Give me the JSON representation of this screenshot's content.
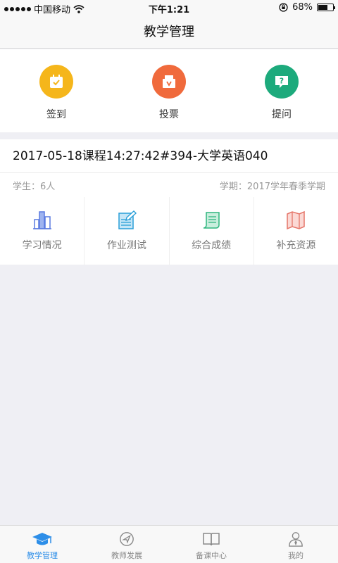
{
  "status": {
    "carrier": "中国移动",
    "time": "下午1:21",
    "battery": "68%",
    "battery_level": 0.68
  },
  "header": {
    "title": "教学管理"
  },
  "quick_actions": [
    {
      "label": "签到",
      "icon": "check-in-icon",
      "color": "#f5b61b"
    },
    {
      "label": "投票",
      "icon": "vote-icon",
      "color": "#f06a3c"
    },
    {
      "label": "提问",
      "icon": "question-icon",
      "color": "#1daa7c"
    }
  ],
  "course": {
    "title": "2017-05-18课程14:27:42#394-大学英语040",
    "students": "学生：6人",
    "term": "学期：2017学年春季学期",
    "tools": [
      {
        "label": "学习情况",
        "icon": "bar-chart-icon"
      },
      {
        "label": "作业测试",
        "icon": "homework-icon"
      },
      {
        "label": "综合成绩",
        "icon": "scroll-icon"
      },
      {
        "label": "补充资源",
        "icon": "map-icon"
      }
    ]
  },
  "tabs": [
    {
      "label": "教学管理",
      "icon": "graduation-cap-icon",
      "active": true
    },
    {
      "label": "教师发展",
      "icon": "compass-icon",
      "active": false
    },
    {
      "label": "备课中心",
      "icon": "book-icon",
      "active": false
    },
    {
      "label": "我的",
      "icon": "profile-icon",
      "active": false
    }
  ],
  "colors": {
    "accent": "#2d8ee8",
    "background": "#efeff4"
  }
}
